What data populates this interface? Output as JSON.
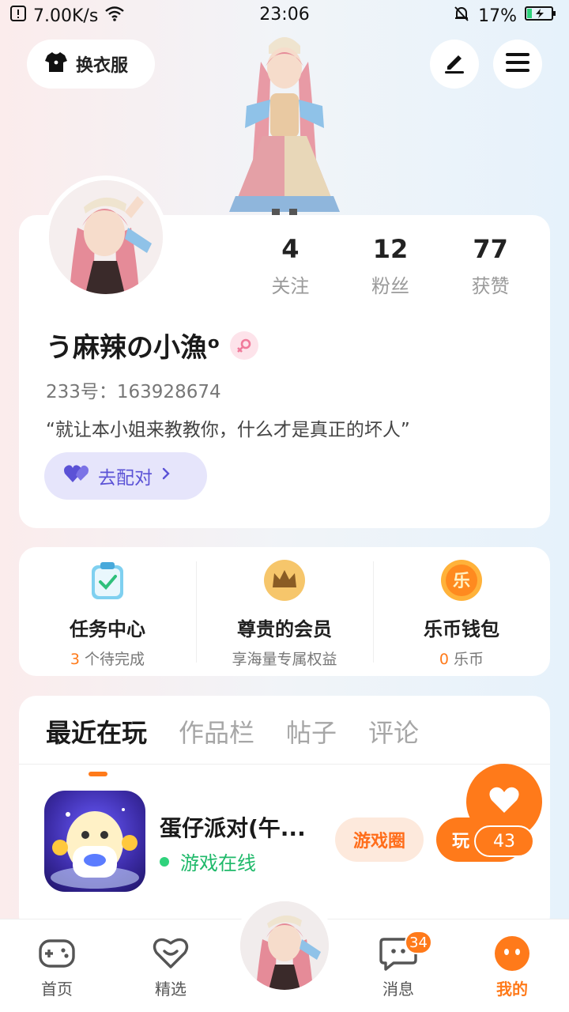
{
  "status_bar": {
    "net_speed": "7.00K/s",
    "time": "23:06",
    "battery": "17%"
  },
  "header": {
    "dress_up_label": "换衣服"
  },
  "profile": {
    "stats": [
      {
        "value": "4",
        "label": "关注"
      },
      {
        "value": "12",
        "label": "粉丝"
      },
      {
        "value": "77",
        "label": "获赞"
      }
    ],
    "name": "う麻辣の小漁ᵒ",
    "uid": "233号：163928674",
    "bio": "“就让本小姐来教教你，什么才是真正的坏人”",
    "match_label": "去配对"
  },
  "features": [
    {
      "title": "任务中心",
      "count": "3",
      "suffix": " 个待完成"
    },
    {
      "title": "尊贵的会员",
      "subtitle": "享海量专属权益"
    },
    {
      "title": "乐币钱包",
      "count": "0",
      "suffix": " 乐币"
    }
  ],
  "tabs": [
    "最近在玩",
    "作品栏",
    "帖子",
    "评论"
  ],
  "game": {
    "title": "蛋仔派对(午...",
    "status": "游戏在线",
    "circle_button": "游戏圈",
    "play_button": "玩"
  },
  "like_count": "43",
  "nav": [
    {
      "label": "首页"
    },
    {
      "label": "精选"
    },
    {
      "label": "消息",
      "badge": "34"
    },
    {
      "label": "我的"
    }
  ],
  "colors": {
    "accent": "#ff7a1a",
    "match": "#5b52d6",
    "online": "#1fb96a"
  }
}
